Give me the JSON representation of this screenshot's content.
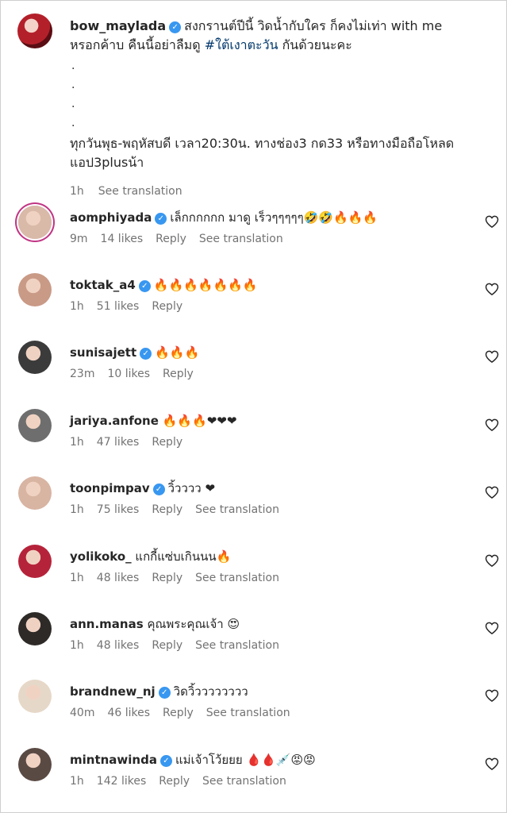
{
  "caption": {
    "username": "bow_maylada",
    "text_line1": "สงกรานต์ปีนี้ วิดน้ำกับใคร ก็คงไม่เท่า with me",
    "text_line2_pre": "หรอกค้าบ คืนนี้อย่าลืมดู ",
    "hashtag": "#ใต้เงาตะวัน",
    "text_line2_post": " กันด้วยนะคะ",
    "dots": [
      ".",
      ".",
      ".",
      "."
    ],
    "text_line3": "ทุกวันพุธ-พฤหัสบดี เวลา20:30น. ทางช่อง3 กด33 หรือทางมือถือโหลด",
    "text_line4": "แอป3plusน้า",
    "time": "1h",
    "see_translation": "See translation"
  },
  "comments": [
    {
      "username": "aomphiyada",
      "verified": true,
      "text": "เล็กกกกกก มาดู เร็วๆๆๆๆๆ🤣🤣🔥🔥🔥",
      "time": "9m",
      "likes": "14 likes",
      "reply": "Reply",
      "translation": "See translation",
      "avatar_color": "#d9b9a8"
    },
    {
      "username": "toktak_a4",
      "verified": true,
      "text": "🔥🔥🔥🔥🔥🔥🔥",
      "time": "1h",
      "likes": "51 likes",
      "reply": "Reply",
      "translation": "",
      "avatar_color": "#c99a86"
    },
    {
      "username": "sunisajett",
      "verified": true,
      "text": "🔥🔥🔥",
      "time": "23m",
      "likes": "10 likes",
      "reply": "Reply",
      "translation": "",
      "avatar_color": "#3b3b3b"
    },
    {
      "username": "jariya.anfone",
      "verified": false,
      "text": "🔥🔥🔥❤❤❤",
      "time": "1h",
      "likes": "47 likes",
      "reply": "Reply",
      "translation": "",
      "avatar_color": "#6e6e6e"
    },
    {
      "username": "toonpimpav",
      "verified": true,
      "text": "วิ้วววว ❤",
      "time": "1h",
      "likes": "75 likes",
      "reply": "Reply",
      "translation": "See translation",
      "avatar_color": "#d8b4a2"
    },
    {
      "username": "yolikoko_",
      "verified": false,
      "text": "แกกี้แซ่บเกินนน🔥",
      "time": "1h",
      "likes": "48 likes",
      "reply": "Reply",
      "translation": "See translation",
      "avatar_color": "#b5233a"
    },
    {
      "username": "ann.manas",
      "verified": false,
      "text": "คุณพระคุณเจ้า 😍",
      "time": "1h",
      "likes": "48 likes",
      "reply": "Reply",
      "translation": "See translation",
      "avatar_color": "#2e2a28"
    },
    {
      "username": "brandnew_nj",
      "verified": true,
      "text": "วิดวิ้วววววววว",
      "time": "40m",
      "likes": "46 likes",
      "reply": "Reply",
      "translation": "See translation",
      "avatar_color": "#e6d8c8"
    },
    {
      "username": "mintnawinda",
      "verified": true,
      "text": "แม่เจ้าโว้ยยย 🩸🩸💉😡😡",
      "time": "1h",
      "likes": "142 likes",
      "reply": "Reply",
      "translation": "See translation",
      "avatar_color": "#5a4a44"
    }
  ],
  "icons": {
    "like": "heart-outline-icon",
    "verified": "verified-badge-icon"
  },
  "colors": {
    "verified": "#3897f0",
    "hashtag": "#00376b",
    "meta": "#737373"
  }
}
